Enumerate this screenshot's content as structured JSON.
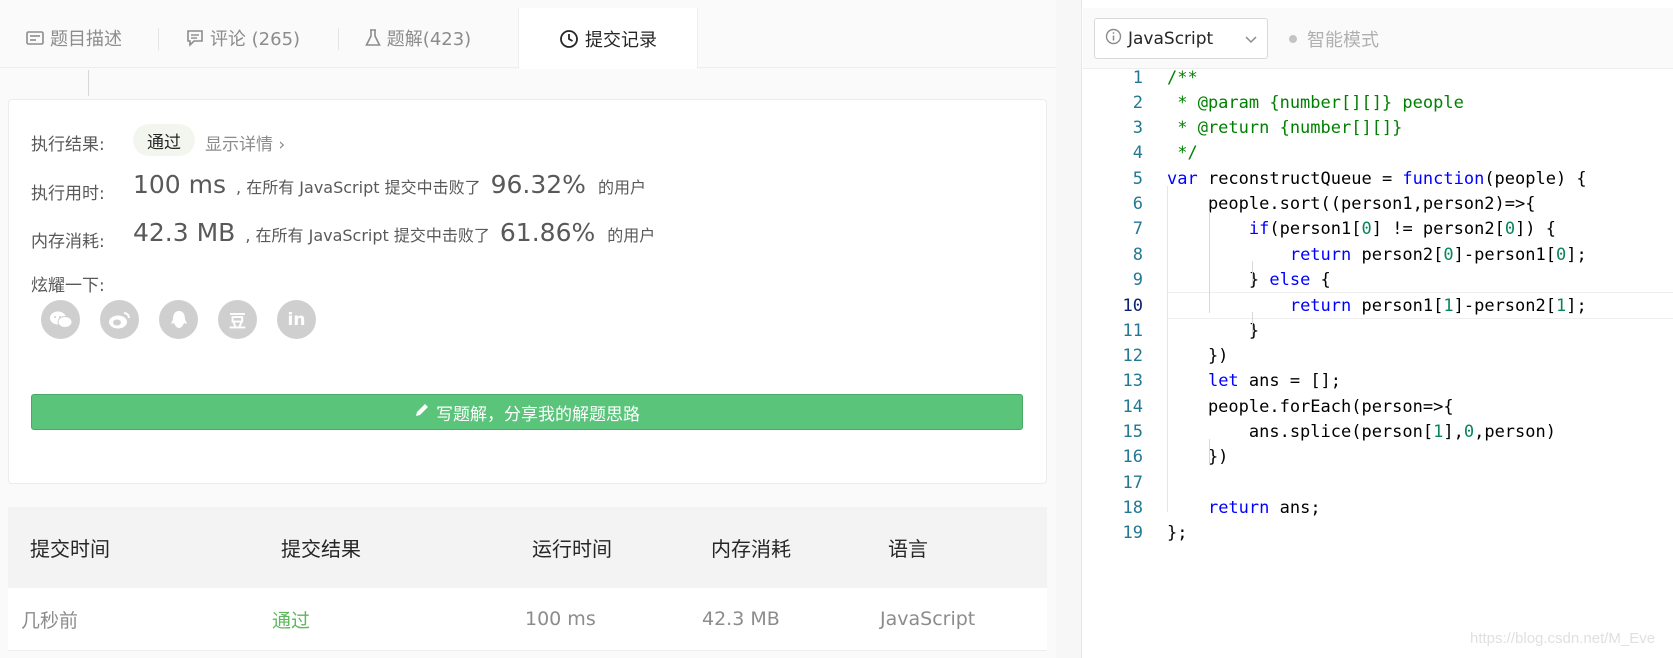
{
  "tabs": [
    {
      "label": "题目描述",
      "icon": "description-icon"
    },
    {
      "label": "评论 (265)",
      "icon": "comment-icon"
    },
    {
      "label": "题解(423)",
      "icon": "flask-icon"
    },
    {
      "label": "提交记录",
      "icon": "clock-icon",
      "active": true
    }
  ],
  "result": {
    "result_label": "执行结果:",
    "status": "通过",
    "detail_link": "显示详情 ›",
    "time_label": "执行用时:",
    "time_value": "100 ms",
    "time_beat_text": ", 在所有 JavaScript 提交中击败了",
    "time_percent": "96.32%",
    "time_tail": "的用户",
    "mem_label": "内存消耗:",
    "mem_value": "42.3 MB",
    "mem_beat_text": ", 在所有 JavaScript 提交中击败了",
    "mem_percent": "61.86%",
    "mem_tail": "的用户",
    "share_label": "炫耀一下:",
    "share_icons": [
      "wechat-icon",
      "weibo-icon",
      "qq-icon",
      "douban-icon",
      "linkedin-icon"
    ],
    "douban_glyph": "豆",
    "linkedin_glyph": "in",
    "write_button": "写题解，分享我的解题思路"
  },
  "submissions": {
    "headers": [
      "提交时间",
      "提交结果",
      "运行时间",
      "内存消耗",
      "语言"
    ],
    "rows": [
      {
        "time": "几秒前",
        "result": "通过",
        "runtime": "100 ms",
        "memory": "42.3 MB",
        "language": "JavaScript"
      }
    ]
  },
  "editor": {
    "language": "JavaScript",
    "smart_mode": "智能模式",
    "current_line": 10,
    "line_numbers": [
      "1",
      "2",
      "3",
      "4",
      "5",
      "6",
      "7",
      "8",
      "9",
      "10",
      "11",
      "12",
      "13",
      "14",
      "15",
      "16",
      "17",
      "18",
      "19"
    ]
  },
  "watermark": "https://blog.csdn.net/M_Eve",
  "colors": {
    "pass_green": "#5cb85c",
    "button_green": "#5ac47a",
    "keyword_blue": "#0000ff",
    "comment_green": "#008000",
    "number_teal": "#098658",
    "line_number": "#237893"
  }
}
